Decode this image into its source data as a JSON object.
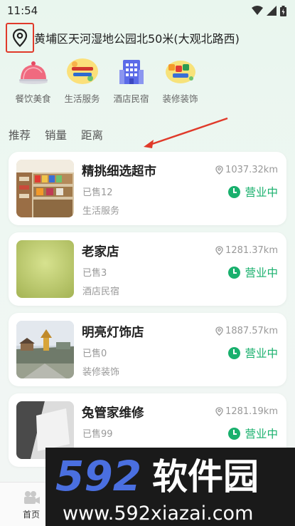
{
  "status_bar": {
    "time": "11:54"
  },
  "location": {
    "text": "黄埔区天河湿地公园北50米(大观北路西)"
  },
  "categories": [
    {
      "label": "餐饮美食",
      "icon": "cloche-icon"
    },
    {
      "label": "生活服务",
      "icon": "life-service-icon"
    },
    {
      "label": "酒店民宿",
      "icon": "hotel-icon"
    },
    {
      "label": "装修装饰",
      "icon": "decoration-icon"
    }
  ],
  "sort_tabs": [
    "推荐",
    "销量",
    "距离"
  ],
  "shops": [
    {
      "name": "精挑细选超市",
      "sold": "已售12",
      "category": "生活服务",
      "distance": "1037.32km",
      "status": "营业中"
    },
    {
      "name": "老家店",
      "sold": "已售3",
      "category": "酒店民宿",
      "distance": "1281.37km",
      "status": "营业中"
    },
    {
      "name": "明亮灯饰店",
      "sold": "已售0",
      "category": "装修装饰",
      "distance": "1887.57km",
      "status": "营业中"
    },
    {
      "name": "兔管家维修",
      "sold": "已售99",
      "category": "",
      "distance": "1281.19km",
      "status": "营业中"
    }
  ],
  "bottom_nav": {
    "home_label": "首页"
  },
  "watermark": {
    "brand": "592软件园",
    "url": "www.592xiazai.com"
  },
  "colors": {
    "accent_green": "#19b06d",
    "highlight_red": "#e03a2a"
  }
}
